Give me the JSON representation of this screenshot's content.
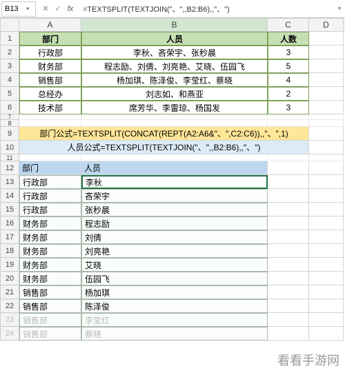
{
  "formula_bar": {
    "cell_ref": "B13",
    "formula": "=TEXTSPLIT(TEXTJOIN(\"、\",,B2:B6),,\"、\")"
  },
  "col_labels": {
    "A": "A",
    "B": "B",
    "C": "C",
    "D": "D"
  },
  "table1": {
    "head": {
      "A": "部门",
      "B": "人员",
      "C": "人数"
    },
    "rows": [
      {
        "A": "行政部",
        "B": "李秋、吝荣宇、张秒晨",
        "C": "3"
      },
      {
        "A": "财务部",
        "B": "程志励、刘倩、刘亮艳、艾晓、伍园飞",
        "C": "5"
      },
      {
        "A": "销售部",
        "B": "杨加琪、陈泽俊、李莹红、蔡晓",
        "C": "4"
      },
      {
        "A": "总经办",
        "B": "刘志如、和燕亚",
        "C": "2"
      },
      {
        "A": "技术部",
        "B": "席芳华、李雷琼、杨国发",
        "C": "3"
      }
    ]
  },
  "formulas_display": {
    "dept": "部门公式=TEXTSPLIT(CONCAT(REPT(A2:A6&\"、\",C2:C6)),,\"、\",1)",
    "person": "人员公式=TEXTSPLIT(TEXTJOIN(\"、\",,B2:B6),,\"、\")"
  },
  "table2": {
    "head": {
      "A": "部门",
      "B": "人员"
    },
    "rows": [
      {
        "A": "行政部",
        "B": "李秋"
      },
      {
        "A": "行政部",
        "B": "吝荣宇"
      },
      {
        "A": "行政部",
        "B": "张秒晨"
      },
      {
        "A": "财务部",
        "B": "程志励"
      },
      {
        "A": "财务部",
        "B": "刘倩"
      },
      {
        "A": "财务部",
        "B": "刘亮艳"
      },
      {
        "A": "财务部",
        "B": "艾晓"
      },
      {
        "A": "财务部",
        "B": "伍园飞"
      },
      {
        "A": "销售部",
        "B": "杨加琪"
      },
      {
        "A": "销售部",
        "B": "陈泽俊"
      },
      {
        "A": "销售部",
        "B": "李莹红"
      },
      {
        "A": "销售部",
        "B": "蔡晓"
      }
    ]
  },
  "watermark": "看看手游网",
  "chart_data": {
    "type": "table",
    "title": "部门人员拆分",
    "columns": [
      "部门",
      "人员",
      "人数"
    ],
    "rows": [
      [
        "行政部",
        "李秋、吝荣宇、张秒晨",
        3
      ],
      [
        "财务部",
        "程志励、刘倩、刘亮艳、艾晓、伍园飞",
        5
      ],
      [
        "销售部",
        "杨加琪、陈泽俊、李莹红、蔡晓",
        4
      ],
      [
        "总经办",
        "刘志如、和燕亚",
        2
      ],
      [
        "技术部",
        "席芳华、李雷琼、杨国发",
        3
      ]
    ]
  }
}
